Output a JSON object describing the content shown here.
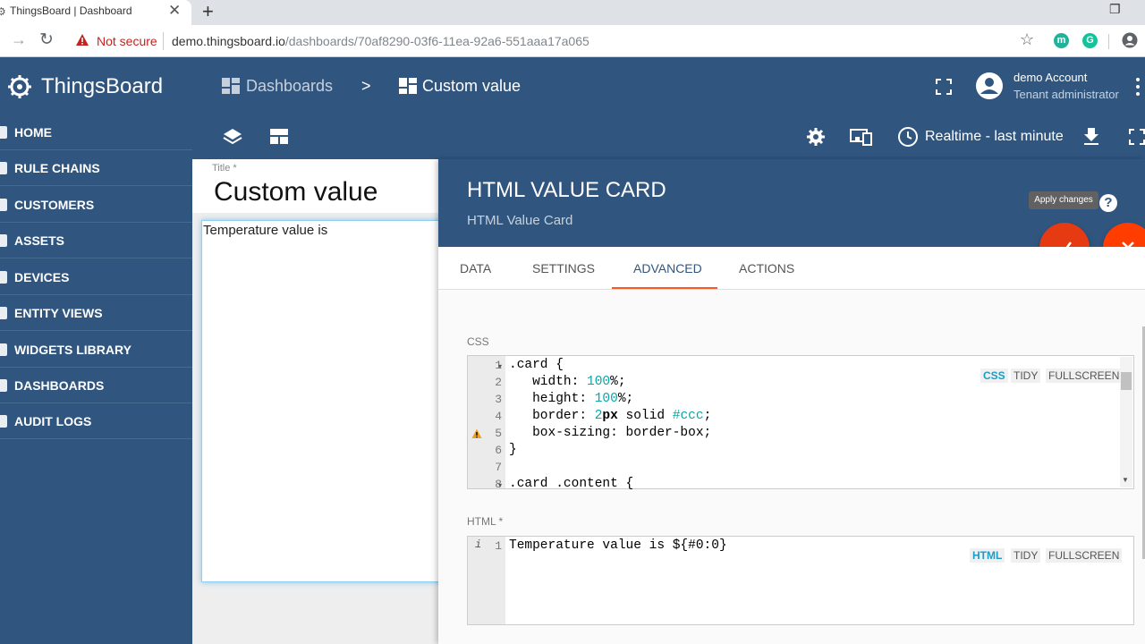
{
  "browser": {
    "tab_title": "ThingsBoard | Dashboard",
    "tab_close": "✕",
    "new_tab": "+",
    "not_secure": "Not secure",
    "url_host": "demo.thingsboard.io",
    "url_path": "/dashboards/70af8290-03f6-11ea-92a6-551aaa17a065",
    "ext_m": "m",
    "ext_g": "G"
  },
  "header": {
    "brand": "ThingsBoard",
    "breadcrumb_root": "Dashboards",
    "breadcrumb_sep": ">",
    "breadcrumb_current": "Custom value",
    "user_name": "demo Account",
    "user_role": "Tenant administrator",
    "time_window": "Realtime - last minute"
  },
  "sidebar": {
    "items": [
      {
        "label": "HOME"
      },
      {
        "label": "RULE CHAINS"
      },
      {
        "label": "CUSTOMERS"
      },
      {
        "label": "ASSETS"
      },
      {
        "label": "DEVICES"
      },
      {
        "label": "ENTITY VIEWS"
      },
      {
        "label": "WIDGETS LIBRARY"
      },
      {
        "label": "DASHBOARDS"
      },
      {
        "label": "AUDIT LOGS"
      }
    ]
  },
  "dashboard": {
    "title_label": "Title *",
    "title_value": "Custom value",
    "widget_text": "Temperature value is"
  },
  "panel": {
    "title": "HTML VALUE CARD",
    "subtitle": "HTML Value Card",
    "tooltip": "Apply changes",
    "help": "?",
    "tabs": [
      {
        "label": "DATA"
      },
      {
        "label": "SETTINGS"
      },
      {
        "label": "ADVANCED"
      },
      {
        "label": "ACTIONS"
      }
    ],
    "active_tab": "ADVANCED",
    "css_label": "CSS",
    "html_label": "HTML *",
    "css_buttons": {
      "mode": "CSS",
      "tidy": "TIDY",
      "fullscreen": "FULLSCREEN"
    },
    "html_buttons": {
      "mode": "HTML",
      "tidy": "TIDY",
      "fullscreen": "FULLSCREEN"
    },
    "css_lines": [
      {
        "n": "1",
        "text": ".card {"
      },
      {
        "n": "2",
        "text": "   width: 100%;"
      },
      {
        "n": "3",
        "text": "   height: 100%;"
      },
      {
        "n": "4",
        "text": "   border: 2px solid #ccc;"
      },
      {
        "n": "5",
        "text": "   box-sizing: border-box;"
      },
      {
        "n": "6",
        "text": "}"
      },
      {
        "n": "7",
        "text": ""
      },
      {
        "n": "8",
        "text": ".card .content {"
      }
    ],
    "html_lines": [
      {
        "n": "1",
        "text": "Temperature value is ${#0:0}"
      }
    ]
  },
  "colors": {
    "primary": "#305680",
    "accent": "#ff5722",
    "fab": "#ff3d00"
  }
}
